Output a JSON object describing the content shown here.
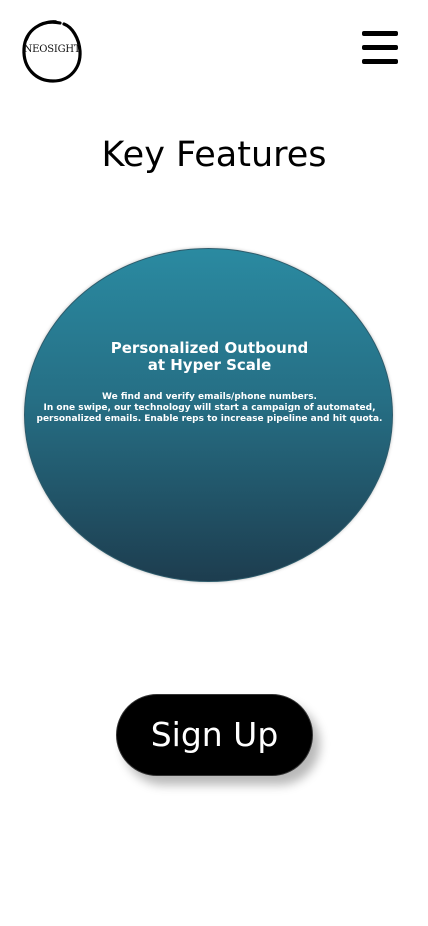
{
  "header": {
    "logo_text": "NEOSIGHT",
    "menu_icon": "hamburger-menu-icon"
  },
  "main": {
    "title": "Key Features",
    "feature": {
      "title_line1": "Personalized Outbound",
      "title_line2": "at Hyper Scale",
      "desc_line1": "We find and verify emails/phone numbers.",
      "desc_line2": "In one swipe, our technology will start a campaign of automated,",
      "desc_line3": "personalized emails. Enable reps to increase pipeline and hit quota."
    },
    "signup_label": "Sign Up"
  },
  "colors": {
    "circle_top": "#2a8aa1",
    "circle_bottom": "#1d3d4f",
    "button_bg": "#000000",
    "text_on_dark": "#ffffff"
  }
}
